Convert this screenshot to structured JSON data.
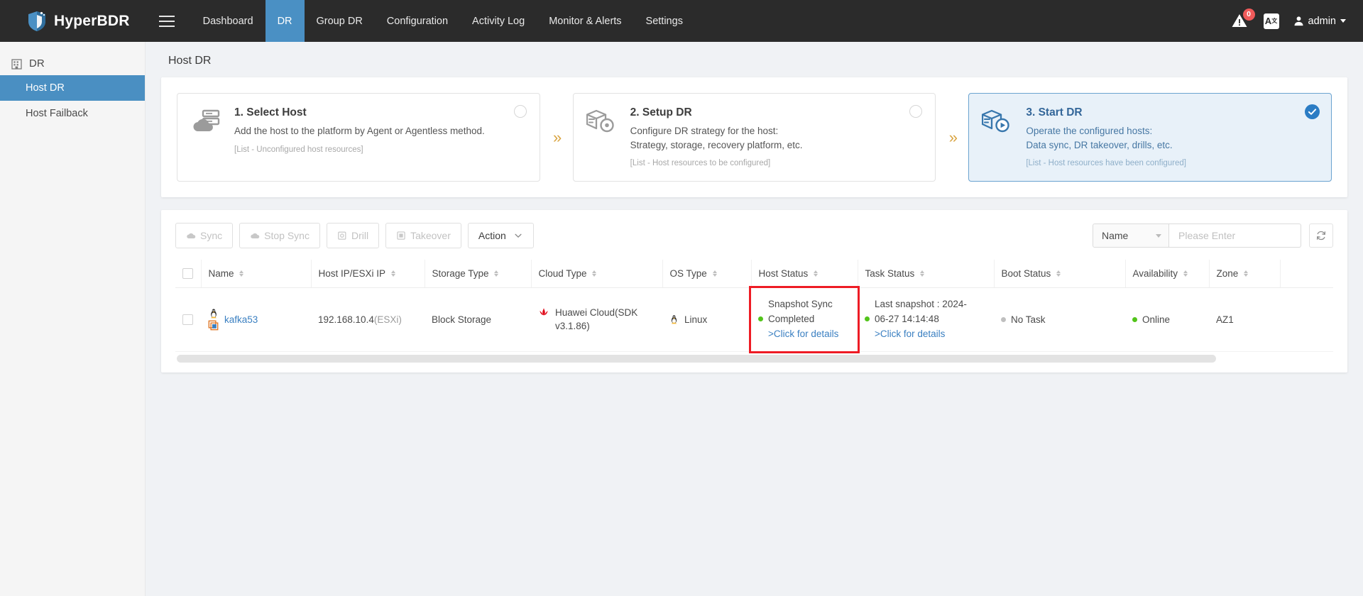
{
  "header": {
    "brand": "HyperBDR",
    "menu_icon": "hamburger-icon",
    "nav": [
      {
        "label": "Dashboard",
        "active": false
      },
      {
        "label": "DR",
        "active": true
      },
      {
        "label": "Group DR",
        "active": false
      },
      {
        "label": "Configuration",
        "active": false
      },
      {
        "label": "Activity Log",
        "active": false
      },
      {
        "label": "Monitor & Alerts",
        "active": false
      },
      {
        "label": "Settings",
        "active": false
      }
    ],
    "alert_badge": "0",
    "lang_label": "A",
    "lang_sup": "文",
    "user": "admin"
  },
  "sidebar": {
    "group_label": "DR",
    "items": [
      {
        "label": "Host DR",
        "active": true
      },
      {
        "label": "Host Failback",
        "active": false
      }
    ]
  },
  "page": {
    "title": "Host DR"
  },
  "wizard": {
    "steps": [
      {
        "title": "1. Select Host",
        "desc_lines": [
          "Add the host to the platform by Agent or Agentless method."
        ],
        "note": "[List - Unconfigured host resources]",
        "active": false,
        "icon": "cloud-server-icon"
      },
      {
        "title": "2. Setup DR",
        "desc_lines": [
          "Configure DR strategy for the host:",
          "Strategy, storage, recovery platform, etc."
        ],
        "note": "[List - Host resources to be configured]",
        "active": false,
        "icon": "dr-setup-icon"
      },
      {
        "title": "3. Start DR",
        "desc_lines": [
          "Operate the configured hosts:",
          "Data sync, DR takeover, drills, etc."
        ],
        "note": "[List - Host resources have been configured]",
        "active": true,
        "icon": "dr-start-icon"
      }
    ],
    "separator": "»",
    "accent_active": "#2b7cc4",
    "accent_bg": "#e8f1f9"
  },
  "toolbar": {
    "buttons": [
      {
        "label": "Sync",
        "icon": "cloud-sync-icon",
        "enabled": false
      },
      {
        "label": "Stop Sync",
        "icon": "cloud-stop-icon",
        "enabled": false
      },
      {
        "label": "Drill",
        "icon": "drill-icon",
        "enabled": false
      },
      {
        "label": "Takeover",
        "icon": "takeover-icon",
        "enabled": false
      }
    ],
    "action_label": "Action",
    "filter_field": "Name",
    "search_placeholder": "Please Enter",
    "search_value": "",
    "refresh_icon": "refresh-icon"
  },
  "table": {
    "columns": [
      {
        "label": "",
        "key": "checkbox",
        "sortable": false
      },
      {
        "label": "Name",
        "sortable": true
      },
      {
        "label": "Host IP/ESXi IP",
        "sortable": true
      },
      {
        "label": "Storage Type",
        "sortable": true
      },
      {
        "label": "Cloud Type",
        "sortable": true
      },
      {
        "label": "OS Type",
        "sortable": true
      },
      {
        "label": "Host Status",
        "sortable": true
      },
      {
        "label": "Task Status",
        "sortable": true
      },
      {
        "label": "Boot Status",
        "sortable": true
      },
      {
        "label": "Availability",
        "sortable": true
      },
      {
        "label": "Zone",
        "sortable": true
      }
    ],
    "rows": [
      {
        "name": "kafka53",
        "name_icons": [
          "linux-penguin-icon",
          "vm-box-icon"
        ],
        "host_ip": "192.168.10.4",
        "host_ip_suffix": "(ESXi)",
        "storage_type": "Block Storage",
        "cloud_type": "Huawei Cloud(SDK v3.1.86)",
        "cloud_icon": "huawei-logo-icon",
        "os_type": "Linux",
        "os_icon": "linux-penguin-icon",
        "host_status_title": "Snapshot Sync",
        "host_status_value": "Completed",
        "host_status_dot": "green",
        "host_status_link": ">Click for details",
        "task_status_title": "Last snapshot : 2024-",
        "task_status_value": "06-27 14:14:48",
        "task_status_dot": "green",
        "task_status_link": ">Click for details",
        "boot_status": "No Task",
        "boot_status_dot": "grey",
        "availability": "Online",
        "availability_dot": "green",
        "zone": "AZ1",
        "highlight_cell": "host_status"
      }
    ],
    "highlight_color": "#ee1c25"
  }
}
